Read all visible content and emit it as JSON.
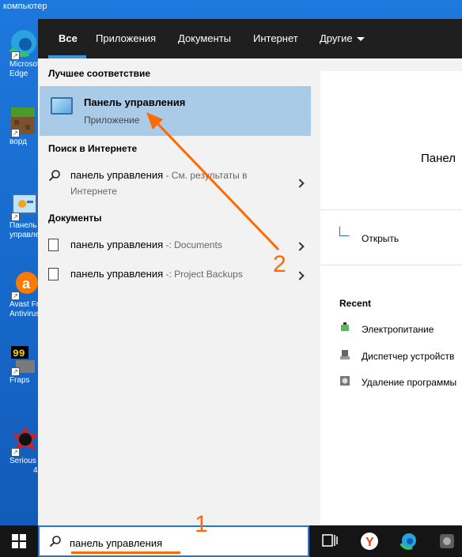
{
  "desktop": {
    "top_label": "компьютер",
    "icons": [
      {
        "label_lines": [
          "Microsoft",
          "Edge"
        ],
        "icon": "edge-icon"
      },
      {
        "label_lines": [
          "ворд"
        ],
        "icon": "minecraft-icon"
      },
      {
        "label_lines": [
          "Панель",
          "управления"
        ],
        "icon": "control-panel-icon"
      },
      {
        "label_lines": [
          "Avast Free",
          "Antivirus"
        ],
        "icon": "avast-icon"
      },
      {
        "label_lines": [
          "Fraps"
        ],
        "icon": "fraps-icon"
      },
      {
        "label_lines": [
          "Serious Sam",
          "4"
        ],
        "icon": "serious-sam-icon"
      }
    ]
  },
  "tabs": {
    "all": "Все",
    "apps": "Приложения",
    "documents": "Документы",
    "internet": "Интернет",
    "other": "Другие"
  },
  "left": {
    "best_match_title": "Лучшее соответствие",
    "best_match": {
      "title": "Панель управления",
      "subtitle": "Приложение"
    },
    "web_title": "Поиск в Интернете",
    "web_result": {
      "query": "панель управления",
      "suffix": " - См. результаты в",
      "suffix2": "Интернете"
    },
    "docs_title": "Документы",
    "docs": [
      {
        "name": "панель управления",
        "location": " -: Documents"
      },
      {
        "name": "панель управления",
        "location": " -: Project Backups"
      }
    ]
  },
  "right": {
    "title": "Панел",
    "open_label": "Открыть",
    "recent_title": "Recent",
    "recent_items": [
      "Электропитание",
      "Диспетчер устройств",
      "Удаление программы"
    ]
  },
  "taskbar": {
    "search_value": "панель управления"
  },
  "annotations": {
    "one": "1",
    "two": "2"
  },
  "colors": {
    "accent": "#1e78dd",
    "selected": "#a9cbe8",
    "annotation": "#ff6a00"
  }
}
